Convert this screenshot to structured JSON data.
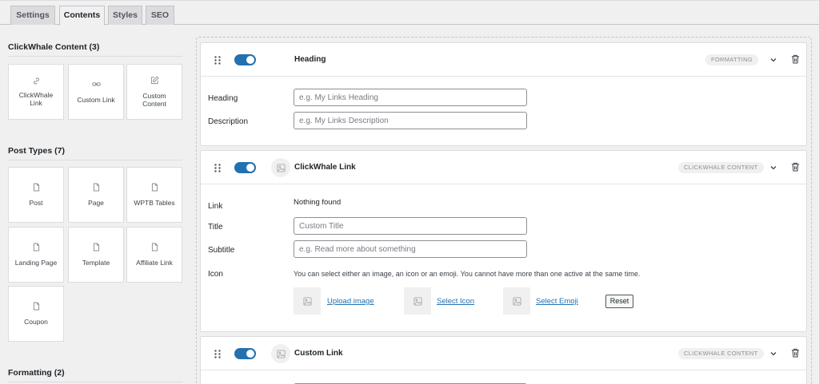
{
  "tabs": [
    {
      "label": "Settings",
      "active": false
    },
    {
      "label": "Contents",
      "active": true
    },
    {
      "label": "Styles",
      "active": false
    },
    {
      "label": "SEO",
      "active": false
    }
  ],
  "sidebar": {
    "clickwhale": {
      "title": "ClickWhale Content (3)",
      "items": [
        {
          "label": "ClickWhale Link",
          "icon": "link-icon"
        },
        {
          "label": "Custom Link",
          "icon": "chain-link-icon"
        },
        {
          "label": "Custom Content",
          "icon": "edit-icon"
        }
      ]
    },
    "post_types": {
      "title": "Post Types (7)",
      "items": [
        {
          "label": "Post",
          "icon": "document-icon"
        },
        {
          "label": "Page",
          "icon": "document-icon"
        },
        {
          "label": "WPTB Tables",
          "icon": "document-icon"
        },
        {
          "label": "Landing Page",
          "icon": "document-icon"
        },
        {
          "label": "Template",
          "icon": "document-icon"
        },
        {
          "label": "Affiliate Link",
          "icon": "document-icon"
        },
        {
          "label": "Coupon",
          "icon": "document-icon"
        }
      ]
    },
    "formatting": {
      "title": "Formatting (2)"
    }
  },
  "blocks": {
    "heading": {
      "title": "Heading",
      "badge": "FORMATTING",
      "enabled": true,
      "fields": {
        "heading": {
          "label": "Heading",
          "value": "",
          "placeholder": "e.g. My Links Heading"
        },
        "description": {
          "label": "Description",
          "value": "",
          "placeholder": "e.g. My Links Description"
        }
      }
    },
    "clickwhale_link": {
      "title": "ClickWhale Link",
      "badge": "CLICKWHALE CONTENT",
      "enabled": true,
      "link": {
        "label": "Link",
        "value": "Nothing found"
      },
      "fields": {
        "title": {
          "label": "Title",
          "value": "",
          "placeholder": "Custom Title"
        },
        "subtitle": {
          "label": "Subtitle",
          "value": "",
          "placeholder": "e.g. Read more about something"
        }
      },
      "icon": {
        "label": "Icon",
        "help": "You can select either an image, an icon or an emoji. You cannot have more than one active at the same time.",
        "upload_label": "Upload image",
        "select_icon_label": "Select Icon",
        "select_emoji_label": "Select Emoji",
        "reset_label": "Reset"
      }
    },
    "custom_link": {
      "title": "Custom Link",
      "badge": "CLICKWHALE CONTENT",
      "enabled": true
    }
  },
  "colors": {
    "accent": "#2271b1",
    "background": "#f0f0f1",
    "badge_bg": "#f0f0f1"
  }
}
